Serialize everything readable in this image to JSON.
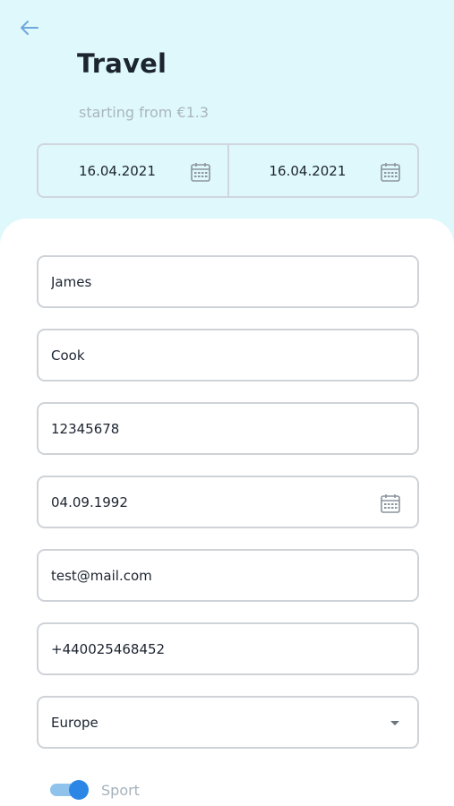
{
  "header": {
    "title": "Travel",
    "subtitle": "starting from €1.3",
    "back_icon": "arrow-left-icon",
    "date_from": "16.04.2021",
    "date_to": "16.04.2021"
  },
  "form": {
    "first_name": "James",
    "last_name": "Cook",
    "id_number": "12345678",
    "birth_date": "04.09.1992",
    "email": "test@mail.com",
    "phone": "+440025468452",
    "region": "Europe"
  },
  "toggle": {
    "label": "Sport",
    "enabled": true
  },
  "colors": {
    "header_bg": "#dff8fb",
    "accent": "#2b86e6",
    "border": "#cfd3d8"
  }
}
